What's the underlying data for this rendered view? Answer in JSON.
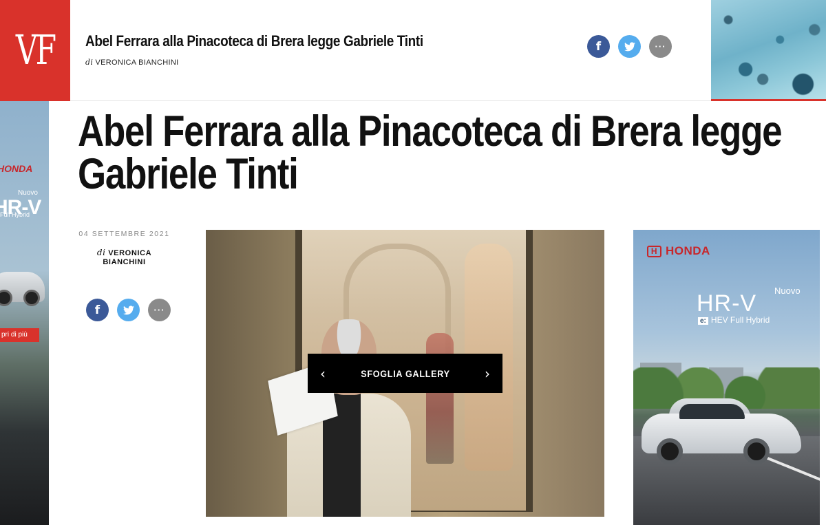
{
  "header": {
    "logo": "VF",
    "title": "Abel Ferrara alla Pinacoteca di Brera legge Gabriele Tinti",
    "byline_prefix": "di",
    "byline_author": "VERONICA BIANCHINI"
  },
  "share": {
    "facebook_icon": "f",
    "twitter_icon": "twitter-bird",
    "more_icon": "···"
  },
  "article": {
    "title": "Abel Ferrara alla Pinacoteca di Brera legge Gabriele Tinti",
    "date": "04 SETTEMBRE 2021",
    "byline_prefix": "di",
    "byline_author_line1": "VERONICA",
    "byline_author_line2": "BIANCHINI"
  },
  "gallery": {
    "label": "SFOGLIA GALLERY",
    "prev_icon": "‹",
    "next_icon": "›"
  },
  "ad_left": {
    "brand": "HONDA",
    "nuovo": "Nuovo",
    "model": "HR-V",
    "sub": "Full Hybrid",
    "cta": "pri di più"
  },
  "ad_right": {
    "brand": "HONDA",
    "nuovo": "Nuovo",
    "model": "HR-V",
    "sub_badge": "e:",
    "sub": "HEV Full Hybrid"
  },
  "colors": {
    "brand_red": "#d9322b",
    "facebook": "#3b5998",
    "twitter": "#55acee",
    "more": "#8a8a8a"
  }
}
